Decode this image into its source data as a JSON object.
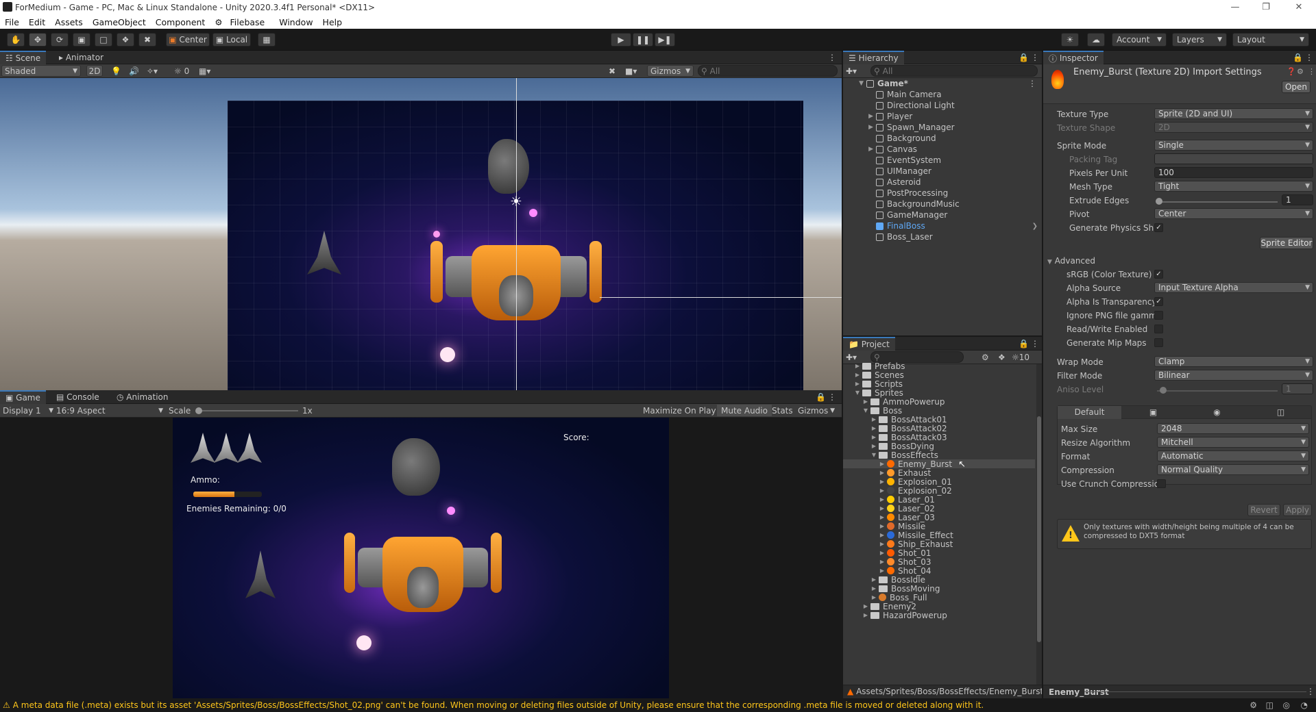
{
  "window": {
    "title": "ForMedium - Game - PC, Mac & Linux Standalone - Unity 2020.3.4f1 Personal* <DX11>"
  },
  "menu": [
    "File",
    "Edit",
    "Assets",
    "GameObject",
    "Component",
    "Filebase",
    "Window",
    "Help"
  ],
  "toolbar": {
    "pivot": "Center",
    "space": "Local",
    "account": "Account",
    "layers": "Layers",
    "layout": "Layout"
  },
  "scene": {
    "tabs": [
      "Scene",
      "Animator"
    ],
    "shading": "Shaded",
    "mode2d": "2D",
    "hidden_count": "0",
    "gizmos": "Gizmos",
    "search_placeholder": "All"
  },
  "game": {
    "tabs": [
      "Game",
      "Console",
      "Animation"
    ],
    "display": "Display 1",
    "aspect": "16:9 Aspect",
    "scale_label": "Scale",
    "scale_value": "1x",
    "maximize": "Maximize On Play",
    "mute": "Mute Audio",
    "stats": "Stats",
    "gizmos": "Gizmos",
    "hud": {
      "score": "Score:",
      "ammo": "Ammo:",
      "ammo_fraction": 0.6,
      "enemies": "Enemies Remaining: 0/0"
    }
  },
  "hierarchy": {
    "tab": "Hierarchy",
    "search_placeholder": "All",
    "scene_name": "Game*",
    "items": [
      {
        "name": "Main Camera",
        "expandable": false
      },
      {
        "name": "Directional Light",
        "expandable": false
      },
      {
        "name": "Player",
        "expandable": true
      },
      {
        "name": "Spawn_Manager",
        "expandable": true
      },
      {
        "name": "Background",
        "expandable": false
      },
      {
        "name": "Canvas",
        "expandable": true
      },
      {
        "name": "EventSystem",
        "expandable": false
      },
      {
        "name": "UIManager",
        "expandable": false
      },
      {
        "name": "Asteroid",
        "expandable": false
      },
      {
        "name": "PostProcessing",
        "expandable": false
      },
      {
        "name": "BackgroundMusic",
        "expandable": false
      },
      {
        "name": "GameManager",
        "expandable": false
      },
      {
        "name": "FinalBoss",
        "expandable": false
      },
      {
        "name": "Boss_Laser",
        "expandable": false
      }
    ]
  },
  "project": {
    "tab": "Project",
    "hidden_count": "10",
    "items": [
      {
        "name": "Prefabs",
        "depth": 1,
        "type": "folder"
      },
      {
        "name": "Scenes",
        "depth": 1,
        "type": "folder"
      },
      {
        "name": "Scripts",
        "depth": 1,
        "type": "folder"
      },
      {
        "name": "Sprites",
        "depth": 1,
        "type": "folder-open"
      },
      {
        "name": "AmmoPowerup",
        "depth": 2,
        "type": "folder"
      },
      {
        "name": "Boss",
        "depth": 2,
        "type": "folder-open"
      },
      {
        "name": "BossAttack01",
        "depth": 3,
        "type": "folder"
      },
      {
        "name": "BossAttack02",
        "depth": 3,
        "type": "folder"
      },
      {
        "name": "BossAttack03",
        "depth": 3,
        "type": "folder"
      },
      {
        "name": "BossDying",
        "depth": 3,
        "type": "folder"
      },
      {
        "name": "BossEffects",
        "depth": 3,
        "type": "folder-open"
      },
      {
        "name": "Enemy_Burst",
        "depth": 4,
        "type": "sprite",
        "color": "#ff6a00"
      },
      {
        "name": "Exhaust",
        "depth": 4,
        "type": "sprite",
        "color": "#ff9a2a"
      },
      {
        "name": "Explosion_01",
        "depth": 4,
        "type": "sprite",
        "color": "#ffb300"
      },
      {
        "name": "Explosion_02",
        "depth": 4,
        "type": "sprite",
        "color": "#444444"
      },
      {
        "name": "Laser_01",
        "depth": 4,
        "type": "sprite",
        "color": "#ffcc00"
      },
      {
        "name": "Laser_02",
        "depth": 4,
        "type": "sprite",
        "color": "#ffd21a"
      },
      {
        "name": "Laser_03",
        "depth": 4,
        "type": "sprite",
        "color": "#ff8a00"
      },
      {
        "name": "Missile",
        "depth": 4,
        "type": "sprite",
        "color": "#e06a2a"
      },
      {
        "name": "Missile_Effect",
        "depth": 4,
        "type": "sprite",
        "color": "#2a6ad8"
      },
      {
        "name": "Ship_Exhaust",
        "depth": 4,
        "type": "sprite",
        "color": "#ff7a1a"
      },
      {
        "name": "Shot_01",
        "depth": 4,
        "type": "sprite",
        "color": "#ff5a00"
      },
      {
        "name": "Shot_03",
        "depth": 4,
        "type": "sprite",
        "color": "#ff8a2a"
      },
      {
        "name": "Shot_04",
        "depth": 4,
        "type": "sprite",
        "color": "#ff6a00"
      },
      {
        "name": "BossIdle",
        "depth": 3,
        "type": "folder"
      },
      {
        "name": "BossMoving",
        "depth": 3,
        "type": "folder"
      },
      {
        "name": "Boss_Full",
        "depth": 3,
        "type": "sprite",
        "color": "#d87a2a"
      },
      {
        "name": "Enemy2",
        "depth": 2,
        "type": "folder"
      },
      {
        "name": "HazardPowerup",
        "depth": 2,
        "type": "folder"
      }
    ],
    "path": "Assets/Sprites/Boss/BossEffects/Enemy_Burst.p"
  },
  "inspector": {
    "tab": "Inspector",
    "title": "Enemy_Burst (Texture 2D) Import Settings",
    "open_button": "Open",
    "texture_type_label": "Texture Type",
    "texture_type": "Sprite (2D and UI)",
    "texture_shape_label": "Texture Shape",
    "texture_shape": "2D",
    "sprite_mode_label": "Sprite Mode",
    "sprite_mode": "Single",
    "packing_tag_label": "Packing Tag",
    "ppu_label": "Pixels Per Unit",
    "ppu": "100",
    "mesh_type_label": "Mesh Type",
    "mesh_type": "Tight",
    "extrude_label": "Extrude Edges",
    "extrude": "1",
    "pivot_label": "Pivot",
    "pivot": "Center",
    "gen_physics_label": "Generate Physics Sha",
    "sprite_editor": "Sprite Editor",
    "advanced_label": "Advanced",
    "srgb_label": "sRGB (Color Texture)",
    "alpha_source_label": "Alpha Source",
    "alpha_source": "Input Texture Alpha",
    "alpha_transp_label": "Alpha Is Transparency",
    "ignore_png_label": "Ignore PNG file gamm",
    "rw_label": "Read/Write Enabled",
    "mip_label": "Generate Mip Maps",
    "wrap_label": "Wrap Mode",
    "wrap": "Clamp",
    "filter_label": "Filter Mode",
    "filter": "Bilinear",
    "aniso_label": "Aniso Level",
    "aniso": "1",
    "platform_default": "Default",
    "max_size_label": "Max Size",
    "max_size": "2048",
    "resize_label": "Resize Algorithm",
    "resize": "Mitchell",
    "format_label": "Format",
    "format": "Automatic",
    "compression_label": "Compression",
    "compression": "Normal Quality",
    "crunch_label": "Use Crunch Compressio",
    "revert": "Revert",
    "apply": "Apply",
    "warning": "Only textures with width/height being multiple of 4 can be compressed to DXT5 format",
    "footer_name": "Enemy_Burst"
  },
  "status": {
    "message": "A meta data file (.meta) exists but its asset 'Assets/Sprites/Boss/BossEffects/Shot_02.png' can't be found. When moving or deleting files outside of Unity, please ensure that the corresponding .meta file is moved or deleted along with it."
  },
  "colors": {
    "accent": "#3a79bb",
    "warning": "#ffc61a",
    "selected_hierarchy": "#5fa8f5"
  }
}
